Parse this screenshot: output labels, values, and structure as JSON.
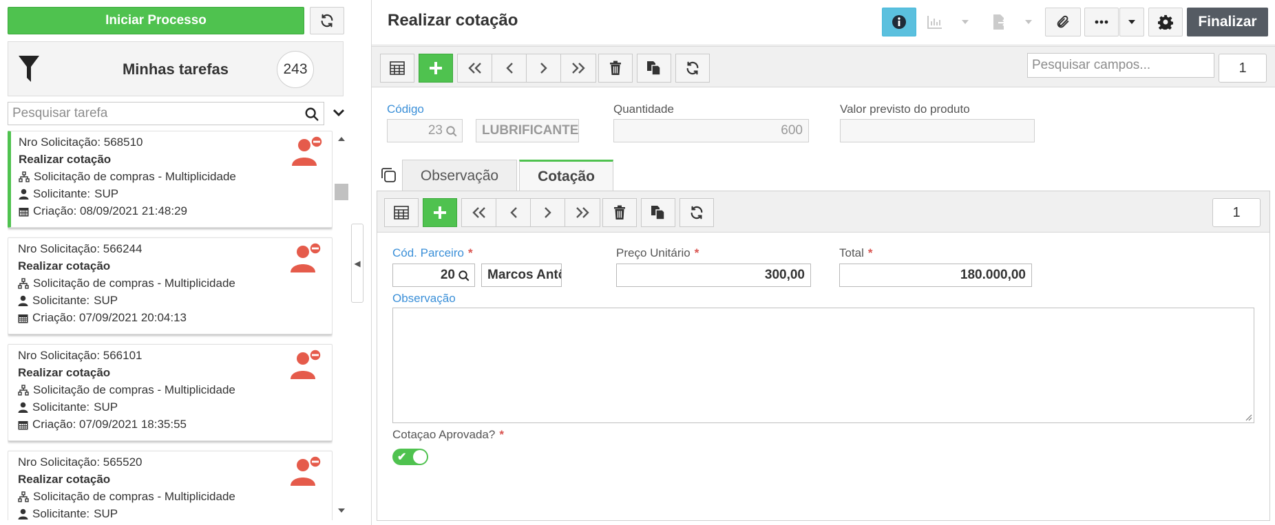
{
  "sidebar": {
    "start_button": "Iniciar Processo",
    "my_tasks_title": "Minhas tarefas",
    "task_count": "243",
    "search_placeholder": "Pesquisar tarefa",
    "tasks": [
      {
        "nro": "Nro Solicitação: 568510",
        "title": "Realizar cotação",
        "process": "Solicitação de compras - Multiplicidade",
        "requester_label": "Solicitante:",
        "requester": "SUP",
        "created": "Criação: 08/09/2021 21:48:29",
        "active": true
      },
      {
        "nro": "Nro Solicitação: 566244",
        "title": "Realizar cotação",
        "process": "Solicitação de compras - Multiplicidade",
        "requester_label": "Solicitante:",
        "requester": "SUP",
        "created": "Criação: 07/09/2021 20:04:13",
        "active": false
      },
      {
        "nro": "Nro Solicitação: 566101",
        "title": "Realizar cotação",
        "process": "Solicitação de compras - Multiplicidade",
        "requester_label": "Solicitante:",
        "requester": "SUP",
        "created": "Criação: 07/09/2021 18:35:55",
        "active": false
      },
      {
        "nro": "Nro Solicitação: 565520",
        "title": "Realizar cotação",
        "process": "Solicitação de compras - Multiplicidade",
        "requester_label": "Solicitante:",
        "requester": "SUP",
        "created": "",
        "active": false
      }
    ]
  },
  "header": {
    "title": "Realizar cotação",
    "finalize_button": "Finalizar"
  },
  "main_toolbar": {
    "search_placeholder": "Pesquisar campos...",
    "page": "1"
  },
  "form": {
    "codigo_label": "Código",
    "codigo_value": "23",
    "codigo_desc": "LUBRIFICANTE",
    "quantidade_label": "Quantidade",
    "quantidade_value": "600",
    "valor_previsto_label": "Valor previsto do produto",
    "valor_previsto_value": ""
  },
  "tabs": [
    {
      "label": "Observação",
      "active": false
    },
    {
      "label": "Cotação",
      "active": true
    }
  ],
  "cotacao": {
    "page": "1",
    "cod_parceiro_label": "Cód. Parceiro",
    "cod_parceiro_value": "20",
    "parceiro_nome": "Marcos Antônio",
    "preco_unitario_label": "Preço Unitário",
    "preco_unitario_value": "300,00",
    "total_label": "Total",
    "total_value": "180.000,00",
    "observacao_label": "Observação",
    "observacao_value": "",
    "aprovada_label": "Cotaçao Aprovada?",
    "aprovada_value": true
  },
  "colors": {
    "accent_green": "#4fc24f",
    "info_blue": "#5bc0de",
    "required_red": "#d9534f",
    "link_blue": "#3a8fd8",
    "user_icon_red": "#e55b4b",
    "finalize_bg": "#555b63"
  },
  "icons": {
    "refresh": "refresh-icon",
    "filter": "filter-icon",
    "search": "search-icon",
    "chevron_down": "chevron-down-icon",
    "user_remove": "user-remove-icon",
    "sitemap": "sitemap-icon",
    "person": "person-icon",
    "calendar": "calendar-icon",
    "info": "info-icon",
    "chart": "chart-icon",
    "document_export": "document-export-icon",
    "paperclip": "paperclip-icon",
    "more": "more-icon",
    "gear": "gear-icon",
    "table": "table-icon",
    "plus": "plus-icon",
    "first": "first-icon",
    "prev": "prev-icon",
    "next": "next-icon",
    "last": "last-icon",
    "trash": "trash-icon",
    "copy": "copy-icon",
    "duplicate": "duplicate-icon"
  }
}
